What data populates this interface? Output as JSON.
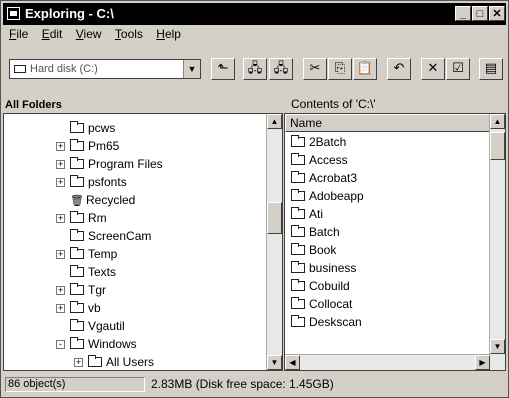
{
  "window": {
    "title": "Exploring - C:\\",
    "minimize_glyph": "_",
    "maximize_glyph": "□",
    "close_glyph": "✕"
  },
  "menu": [
    "File",
    "Edit",
    "View",
    "Tools",
    "Help"
  ],
  "toolbar": {
    "drive_value": "Hard disk (C:)",
    "buttons": [
      {
        "name": "up-one-level-icon",
        "glyph": "⬑"
      },
      {
        "name": "map-network-drive-icon",
        "glyph": "🖧"
      },
      {
        "name": "disconnect-network-drive-icon",
        "glyph": "🖧"
      },
      {
        "name": "cut-icon",
        "glyph": "✂"
      },
      {
        "name": "copy-icon",
        "glyph": "⎘"
      },
      {
        "name": "paste-icon",
        "glyph": "📋"
      },
      {
        "name": "undo-icon",
        "glyph": "↶"
      },
      {
        "name": "delete-icon",
        "glyph": "✕"
      },
      {
        "name": "properties-icon",
        "glyph": "☑"
      },
      {
        "name": "large-icons-icon",
        "glyph": "▤"
      }
    ]
  },
  "labels": {
    "all_folders": "All Folders",
    "contents_of": "Contents of 'C:\\'"
  },
  "tree": [
    {
      "label": "pcws",
      "expander": ""
    },
    {
      "label": "Pm65",
      "expander": "+"
    },
    {
      "label": "Program Files",
      "expander": "+"
    },
    {
      "label": "psfonts",
      "expander": "+"
    },
    {
      "label": "Recycled",
      "expander": ""
    },
    {
      "label": "Rm",
      "expander": "+"
    },
    {
      "label": "ScreenCam",
      "expander": ""
    },
    {
      "label": "Temp",
      "expander": "+"
    },
    {
      "label": "Texts",
      "expander": ""
    },
    {
      "label": "Tgr",
      "expander": "+"
    },
    {
      "label": "vb",
      "expander": "+"
    },
    {
      "label": "Vgautil",
      "expander": ""
    },
    {
      "label": "Windows",
      "expander": "-"
    },
    {
      "label": "All Users",
      "expander": "+"
    }
  ],
  "list": {
    "column_name": "Name",
    "items": [
      "2Batch",
      "Access",
      "Acrobat3",
      "Adobeapp",
      "Ati",
      "Batch",
      "Book",
      "business",
      "Cobuild",
      "Collocat",
      "Deskscan"
    ]
  },
  "status": {
    "objects": "86 object(s)",
    "disk": "2.83MB (Disk free space: 1.45GB)"
  }
}
